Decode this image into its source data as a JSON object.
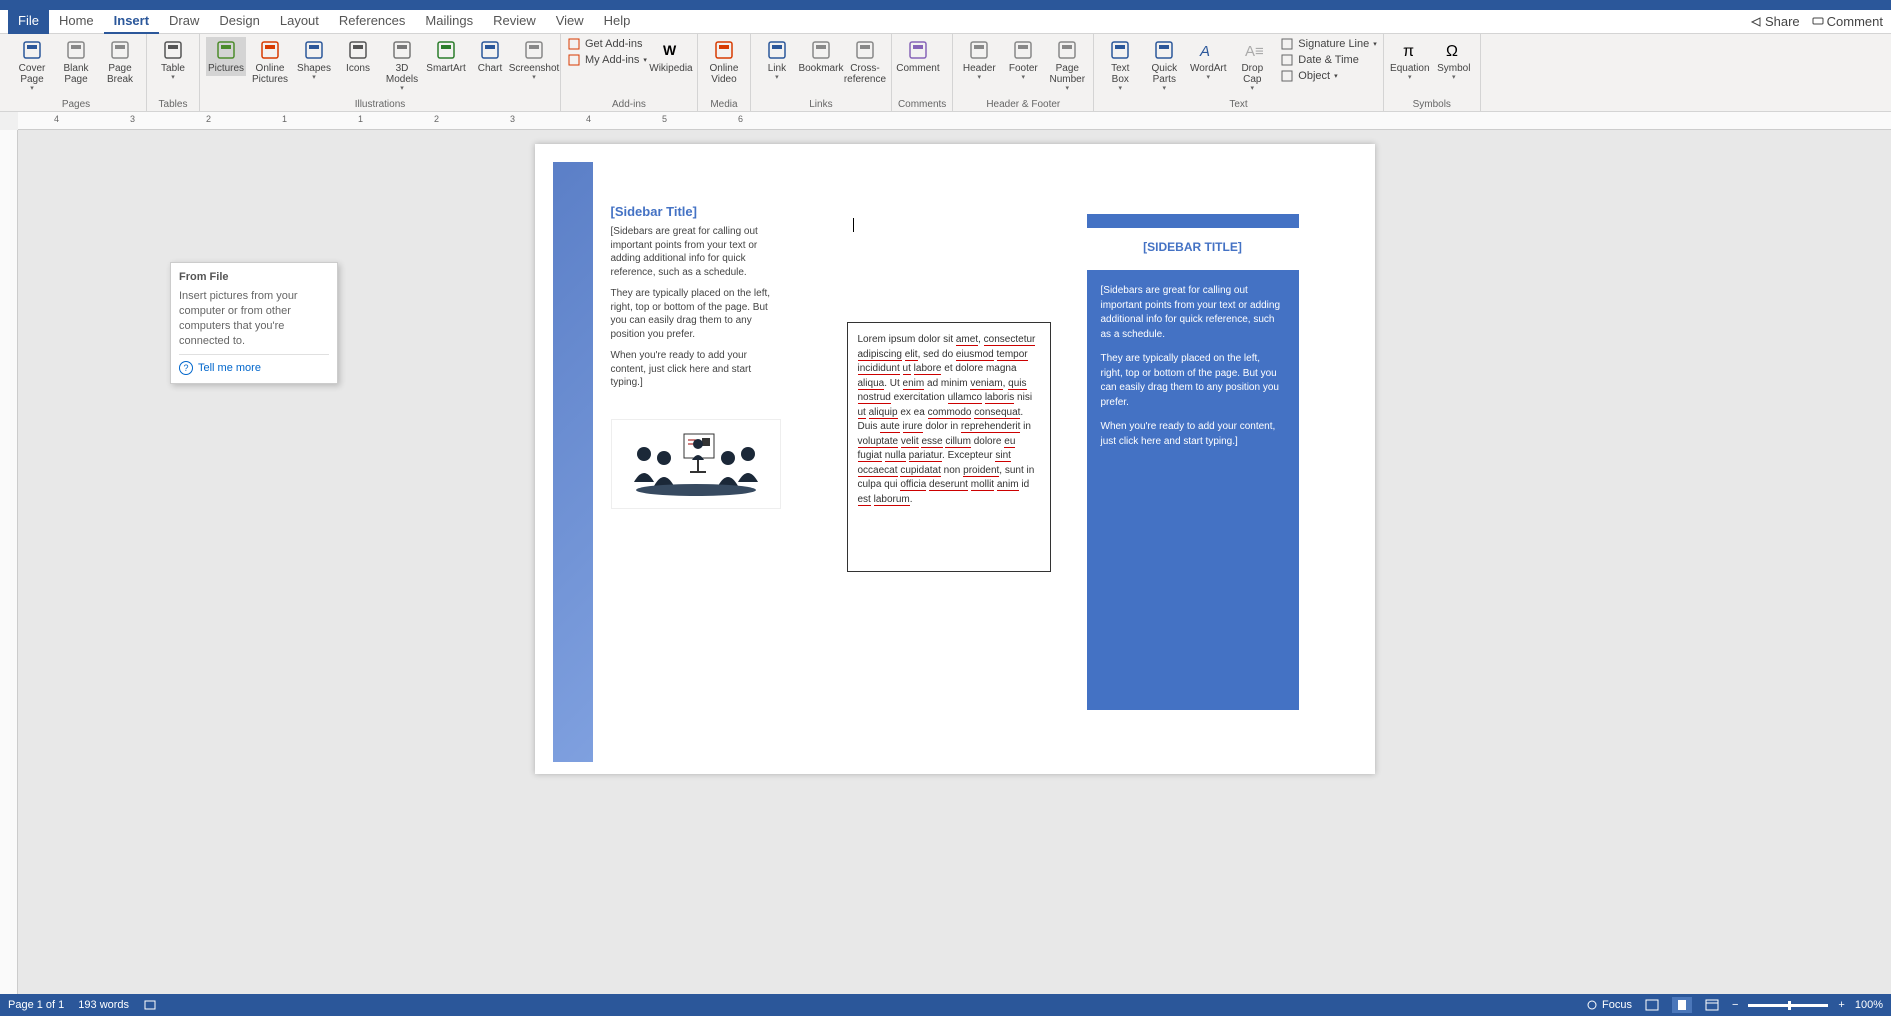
{
  "titlebar": {},
  "menubar": {
    "tabs": [
      "File",
      "Home",
      "Insert",
      "Draw",
      "Design",
      "Layout",
      "References",
      "Mailings",
      "Review",
      "View",
      "Help"
    ],
    "active_index": 2,
    "share": "Share",
    "comment": "Comment"
  },
  "ribbon": {
    "groups": [
      {
        "label": "Pages",
        "items": [
          {
            "label": "Cover Page",
            "dd": true
          },
          {
            "label": "Blank Page"
          },
          {
            "label": "Page Break"
          }
        ]
      },
      {
        "label": "Tables",
        "items": [
          {
            "label": "Table",
            "dd": true
          }
        ]
      },
      {
        "label": "Illustrations",
        "items": [
          {
            "label": "Pictures",
            "hl": true
          },
          {
            "label": "Online Pictures"
          },
          {
            "label": "Shapes",
            "dd": true
          },
          {
            "label": "Icons"
          },
          {
            "label": "3D Models",
            "dd": true
          },
          {
            "label": "SmartArt"
          },
          {
            "label": "Chart"
          },
          {
            "label": "Screenshot",
            "dd": true
          }
        ]
      },
      {
        "label": "Add-ins",
        "small": [
          {
            "label": "Get Add-ins"
          },
          {
            "label": "My Add-ins",
            "dd": true
          }
        ],
        "items": [
          {
            "label": "Wikipedia"
          }
        ]
      },
      {
        "label": "Media",
        "items": [
          {
            "label": "Online Video"
          }
        ]
      },
      {
        "label": "Links",
        "items": [
          {
            "label": "Link",
            "dd": true
          },
          {
            "label": "Bookmark"
          },
          {
            "label": "Cross-reference"
          }
        ]
      },
      {
        "label": "Comments",
        "items": [
          {
            "label": "Comment"
          }
        ]
      },
      {
        "label": "Header & Footer",
        "items": [
          {
            "label": "Header",
            "dd": true
          },
          {
            "label": "Footer",
            "dd": true
          },
          {
            "label": "Page Number",
            "dd": true
          }
        ]
      },
      {
        "label": "Text",
        "items": [
          {
            "label": "Text Box",
            "dd": true
          },
          {
            "label": "Quick Parts",
            "dd": true
          },
          {
            "label": "WordArt",
            "dd": true
          },
          {
            "label": "Drop Cap",
            "dd": true
          }
        ],
        "small": [
          {
            "label": "Signature Line",
            "dd": true
          },
          {
            "label": "Date & Time"
          },
          {
            "label": "Object",
            "dd": true
          }
        ]
      },
      {
        "label": "Symbols",
        "items": [
          {
            "label": "Equation",
            "dd": true
          },
          {
            "label": "Symbol",
            "dd": true
          }
        ]
      }
    ]
  },
  "tooltip": {
    "title": "From File",
    "body": "Insert pictures from your computer or from other computers that you're connected to.",
    "more": "Tell me more"
  },
  "doc": {
    "sidebar_left": {
      "title": "[Sidebar Title]",
      "p1": "[Sidebars are great for calling out important points from your text or adding additional info for quick reference, such as a schedule.",
      "p2": "They are typically placed on the left, right, top or bottom of the page. But you can easily drag them to any position you prefer.",
      "p3": "When you're ready to add your content, just click here and start typing.]"
    },
    "textbox": "Lorem ipsum dolor sit amet, consectetur adipiscing elit, sed do eiusmod tempor incididunt ut labore et dolore magna aliqua. Ut enim ad minim veniam, quis nostrud exercitation ullamco laboris nisi ut aliquip ex ea commodo consequat. Duis aute irure dolor in reprehenderit in voluptate velit esse cillum dolore eu fugiat nulla pariatur. Excepteur sint occaecat cupidatat non proident, sunt in culpa qui officia deserunt mollit anim id est laborum.",
    "sidebar_right": {
      "title": "[SIDEBAR TITLE]",
      "p1": "[Sidebars are great for calling out important points from your text or adding additional info for quick reference, such as a schedule.",
      "p2": "They are typically placed on the left, right, top or bottom of the page. But you can easily drag them to any position you prefer.",
      "p3": "When you're ready to add your content, just click here and start typing.]"
    }
  },
  "statusbar": {
    "page": "Page 1 of 1",
    "words": "193 words",
    "focus": "Focus",
    "zoom": "100%"
  },
  "ruler_ticks": [
    "4",
    "3",
    "2",
    "1",
    "1",
    "2",
    "3",
    "4",
    "5",
    "6"
  ]
}
